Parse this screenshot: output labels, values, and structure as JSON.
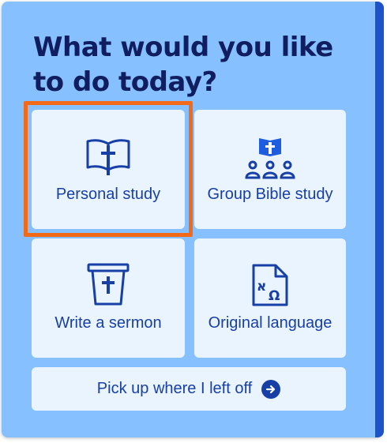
{
  "heading": "What would you like to do today?",
  "options": {
    "personal_study": {
      "label": "Personal study",
      "icon": "open-bible-icon"
    },
    "group_study": {
      "label": "Group Bible study",
      "icon": "group-bible-icon"
    },
    "sermon": {
      "label": "Write a sermon",
      "icon": "pulpit-icon"
    },
    "original_language": {
      "label": "Original language",
      "icon": "original-language-document-icon"
    }
  },
  "resume": {
    "label": "Pick up where I left off",
    "icon": "arrow-right-circle-icon"
  },
  "colors": {
    "panel_background": "#86c0ff",
    "panel_edge": "#1d52c9",
    "card_background": "#e9f4ff",
    "heading_text": "#101d5e",
    "accent": "#173fa6",
    "highlight": "#f26a18"
  }
}
